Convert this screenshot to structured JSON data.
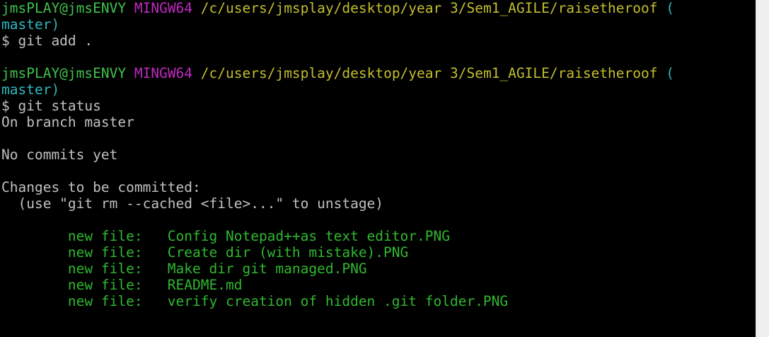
{
  "terminal": {
    "prompt1": {
      "user": "jmsPLAY@jmsENVY",
      "env": "MINGW64",
      "path": "/c/users/jmsplay/desktop/year 3/Sem1_AGILE/raisetheroof",
      "branch_open": "(",
      "branch": "master)"
    },
    "cmd1": "$ git add .",
    "prompt2": {
      "user": "jmsPLAY@jmsENVY",
      "env": "MINGW64",
      "path": "/c/users/jmsplay/desktop/year 3/Sem1_AGILE/raisetheroof",
      "branch_open": "(",
      "branch": "master)"
    },
    "cmd2": "$ git status",
    "output": {
      "on_branch": "On branch master",
      "no_commits": "No commits yet",
      "changes_header": "Changes to be committed:",
      "hint": "  (use \"git rm --cached <file>...\" to unstage)",
      "files": [
        "        new file:   Config Notepad++as text editor.PNG",
        "        new file:   Create dir (with mistake).PNG",
        "        new file:   Make dir git managed.PNG",
        "        new file:   README.md",
        "        new file:   verify creation of hidden .git folder.PNG"
      ]
    }
  },
  "colors": {
    "background": "#000000",
    "user": "#3fc24a",
    "env": "#c028c0",
    "path": "#c3bd2e",
    "branch": "#2fb8c0",
    "default_text": "#c0c0c0",
    "staged_file": "#2fb82f"
  }
}
